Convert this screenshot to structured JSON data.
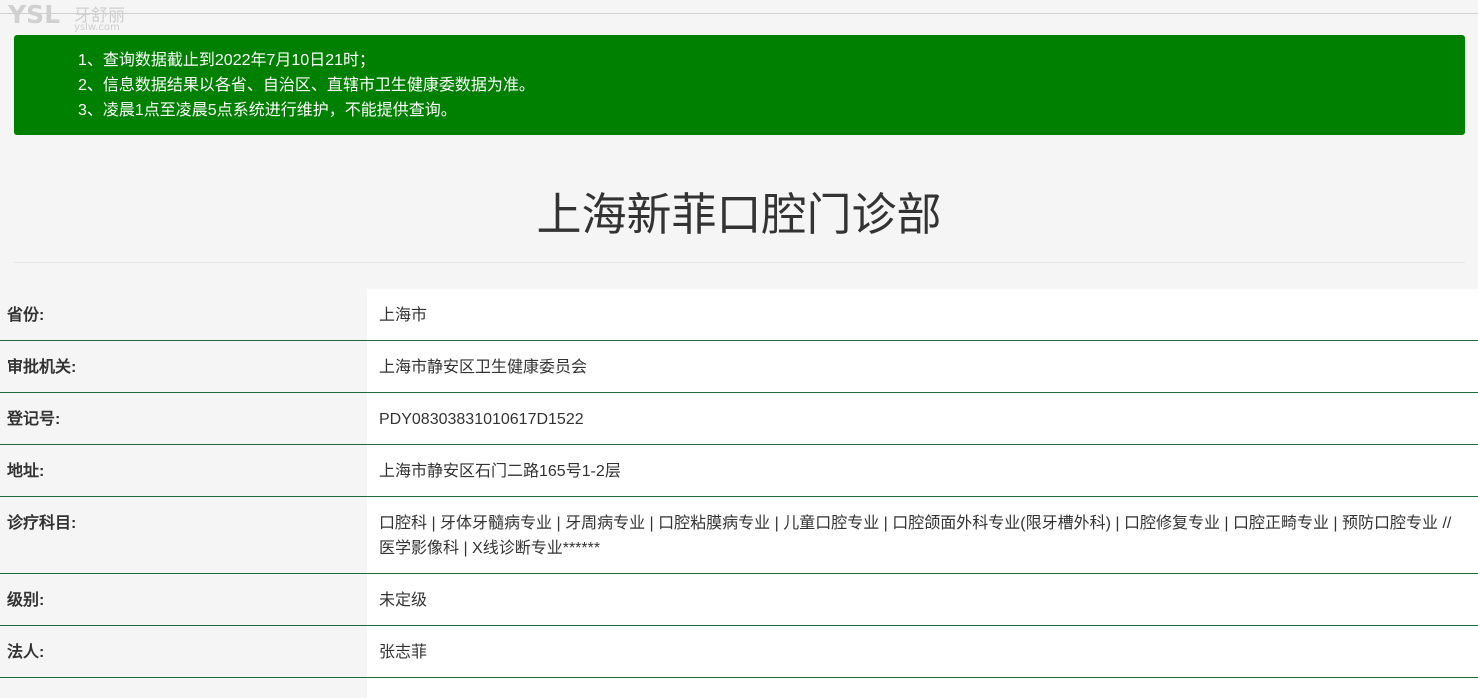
{
  "watermark": {
    "brand": "YSL",
    "name_cn": "牙舒丽",
    "domain": "yslw.com"
  },
  "notice": {
    "color": "#008000",
    "lines": [
      "1、查询数据截止到2022年7月10日21时；",
      "2、信息数据结果以各省、自治区、直辖市卫生健康委数据为准。",
      "3、凌晨1点至凌晨5点系统进行维护，不能提供查询。"
    ]
  },
  "title": "上海新菲口腔门诊部",
  "info": [
    {
      "label": "省份:",
      "value": "上海市"
    },
    {
      "label": "审批机关:",
      "value": "上海市静安区卫生健康委员会"
    },
    {
      "label": "登记号:",
      "value": "PDY08303831010617D1522"
    },
    {
      "label": "地址:",
      "value": "上海市静安区石门二路165号1-2层"
    },
    {
      "label": "诊疗科目:",
      "value": "口腔科 | 牙体牙髓病专业 | 牙周病专业 | 口腔粘膜病专业 | 儿童口腔专业 | 口腔颌面外科专业(限牙槽外科) | 口腔修复专业 | 口腔正畸专业 | 预防口腔专业 //医学影像科 | X线诊断专业******"
    },
    {
      "label": "级别:",
      "value": "未定级"
    },
    {
      "label": "法人:",
      "value": "张志菲"
    }
  ]
}
